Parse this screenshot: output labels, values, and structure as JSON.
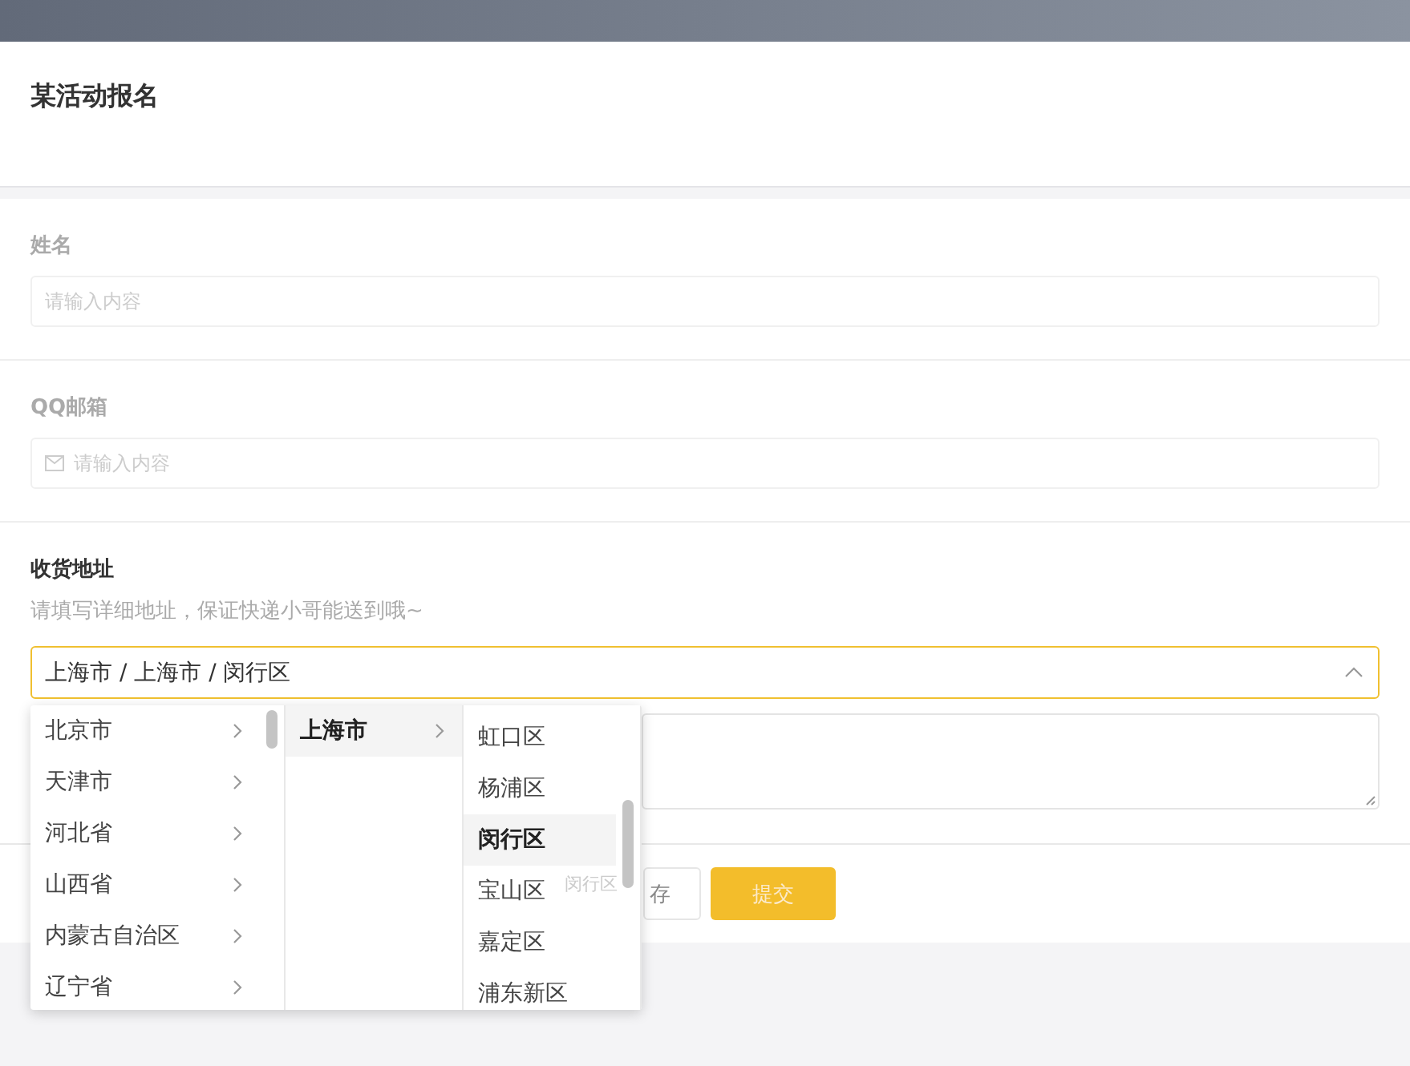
{
  "header": {
    "title": "某活动报名"
  },
  "fields": [
    {
      "kind": "input",
      "label": "姓名",
      "placeholder": "请输入内容"
    },
    {
      "kind": "input_icon",
      "label": "QQ邮箱",
      "placeholder": "请输入内容"
    },
    {
      "kind": "cascader",
      "label": "收货地址",
      "hint": "请填写详细地址，保证快递小哥能送到哦~",
      "value": "上海市 / 上海市 / 闵行区",
      "expanded": true
    }
  ],
  "cascader_menu": {
    "columns": [
      {
        "items": [
          {
            "label": "北京市",
            "has_children": true,
            "selected": false
          },
          {
            "label": "天津市",
            "has_children": true,
            "selected": false
          },
          {
            "label": "河北省",
            "has_children": true,
            "selected": false
          },
          {
            "label": "山西省",
            "has_children": true,
            "selected": false
          },
          {
            "label": "内蒙古自治区",
            "has_children": true,
            "selected": false
          },
          {
            "label": "辽宁省",
            "has_children": true,
            "selected": false
          }
        ]
      },
      {
        "items": [
          {
            "label": "上海市",
            "has_children": true,
            "selected": true
          }
        ]
      },
      {
        "items": [
          {
            "label": "虹口区",
            "has_children": false,
            "selected": false
          },
          {
            "label": "杨浦区",
            "has_children": false,
            "selected": false
          },
          {
            "label": "闵行区",
            "has_children": false,
            "selected": true
          },
          {
            "label": "宝山区",
            "has_children": false,
            "selected": false
          },
          {
            "label": "嘉定区",
            "has_children": false,
            "selected": false
          },
          {
            "label": "浦东新区",
            "has_children": false,
            "selected": false
          }
        ]
      }
    ]
  },
  "drag_ghost": "闵行区",
  "buttons": [
    {
      "kind": "secondary",
      "label": "存"
    },
    {
      "kind": "primary",
      "label": "提交"
    }
  ]
}
